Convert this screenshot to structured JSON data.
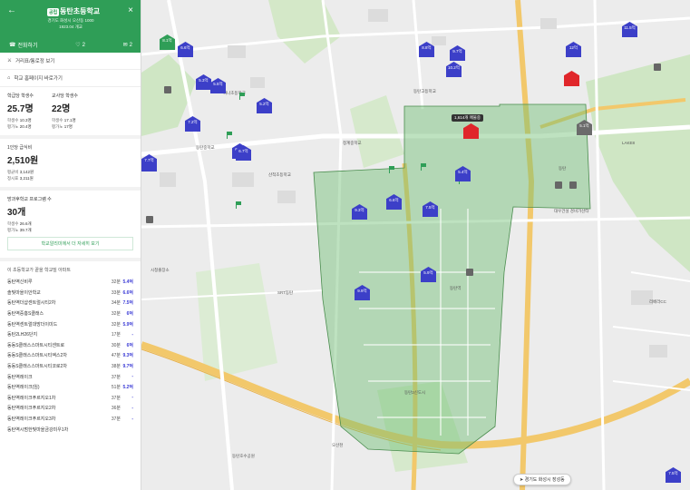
{
  "header": {
    "badge": "공립",
    "title": "동탄초등학교",
    "address": "경기도 화성시 오산동 1000",
    "founded": "1923.04 개교",
    "actions": {
      "call": "전화하기",
      "likes": "2",
      "comments": "2"
    }
  },
  "panel": {
    "directions": "거리표/통로정 보기",
    "homepage": "학교 홈페이지 바로가기",
    "students_per_class": {
      "label": "학급당 학생수",
      "value": "25.7명",
      "sub1_label": "학생수",
      "sub1_value": "10.3명",
      "sub2_label": "평가노",
      "sub2_value": "20.4명"
    },
    "students_per_teacher": {
      "label": "교사당 학생수",
      "value": "22명",
      "sub1_label": "학생수",
      "sub1_value": "17.1명",
      "sub2_label": "평가노",
      "sub2_value": "17명"
    },
    "cost": {
      "label": "1인당 급식비",
      "value": "2,510원",
      "sub1_label": "평균비",
      "sub1_value": "3,142원",
      "sub2_label": "정시표",
      "sub2_value": "3,211원"
    },
    "after_school": {
      "label": "방과후학교 프로그램 수",
      "value": "30개",
      "sub1_label": "학생수",
      "sub1_value": "26.6개",
      "sub2_label": "평가노",
      "sub2_value": "39.7개"
    },
    "more_link": "학교알리미에서 더 자세히 보기",
    "list_title": "이 초등학교가 끝을 학교밀 아파트",
    "academies": [
      {
        "name": "동탄역신비루",
        "dist": "32분",
        "score": "5.4억"
      },
      {
        "name": "솔빛마을이안학교",
        "dist": "33분",
        "score": "6.6억"
      },
      {
        "name": "동탄역더샵센트럴시티2차",
        "dist": "34분",
        "score": "7.5억"
      },
      {
        "name": "동탄역중흥S클래스",
        "dist": "32분",
        "score": "6억"
      },
      {
        "name": "동탄역센트럴대방더이미드",
        "dist": "32분",
        "score": "5.9억"
      },
      {
        "name": "동탄2LH26단지",
        "dist": "17분",
        "score": "-"
      },
      {
        "name": "동동S클래스스마트시티센트로",
        "dist": "30분",
        "score": "6억"
      },
      {
        "name": "동동S클래스스마트시티엑스2차",
        "dist": "47분",
        "score": "9.3억"
      },
      {
        "name": "동동S클래스스마트시티코로2차",
        "dist": "38분",
        "score": "9.7억"
      },
      {
        "name": "동탄역레이크",
        "dist": "37분",
        "score": "-"
      },
      {
        "name": "동탄역레이크(임)",
        "dist": "51분",
        "score": "5.2억"
      },
      {
        "name": "동탄역레이크푸르지오1차",
        "dist": "37분",
        "score": "-"
      },
      {
        "name": "동탄역레이크푸르지오2차",
        "dist": "36분",
        "score": "-"
      },
      {
        "name": "동탄역레이크푸르지오3차",
        "dist": "37분",
        "score": "-"
      },
      {
        "name": "동탄역시범한빛마을금강미우1차",
        "dist": "",
        "score": ""
      }
    ]
  },
  "map": {
    "search_button": "경기도 화성시 장성동",
    "cluster_label": "1,614개 매물중",
    "labels": [
      "하나초등학교",
      "동탄고등학교",
      "동탄중학교",
      "청계중학교",
      "산척초등학교",
      "시청출장소",
      "동탄역",
      "SRT동탄",
      "동탄호수공원",
      "오산천",
      "LAKE8",
      "리베라CC",
      "대우건설 경비가산타",
      "동탄",
      "동탄2신도시"
    ],
    "markers": [
      "7.1억",
      "6.6억",
      "5.5억",
      "7.2억",
      "6.5억",
      "6.6억",
      "7.5억",
      "9.3억",
      "9.9억",
      "5.9억",
      "5.4억",
      "10.2억",
      "9.7억",
      "8.8억",
      "5.1억",
      "11.5억",
      "12억",
      "7.7억",
      "6.7억",
      "5.2억",
      "8.1억",
      "5.3억"
    ],
    "colors": {
      "primary": "#3c3fc8",
      "school_green": "#2f9e57",
      "area": "#6fbf73"
    }
  }
}
